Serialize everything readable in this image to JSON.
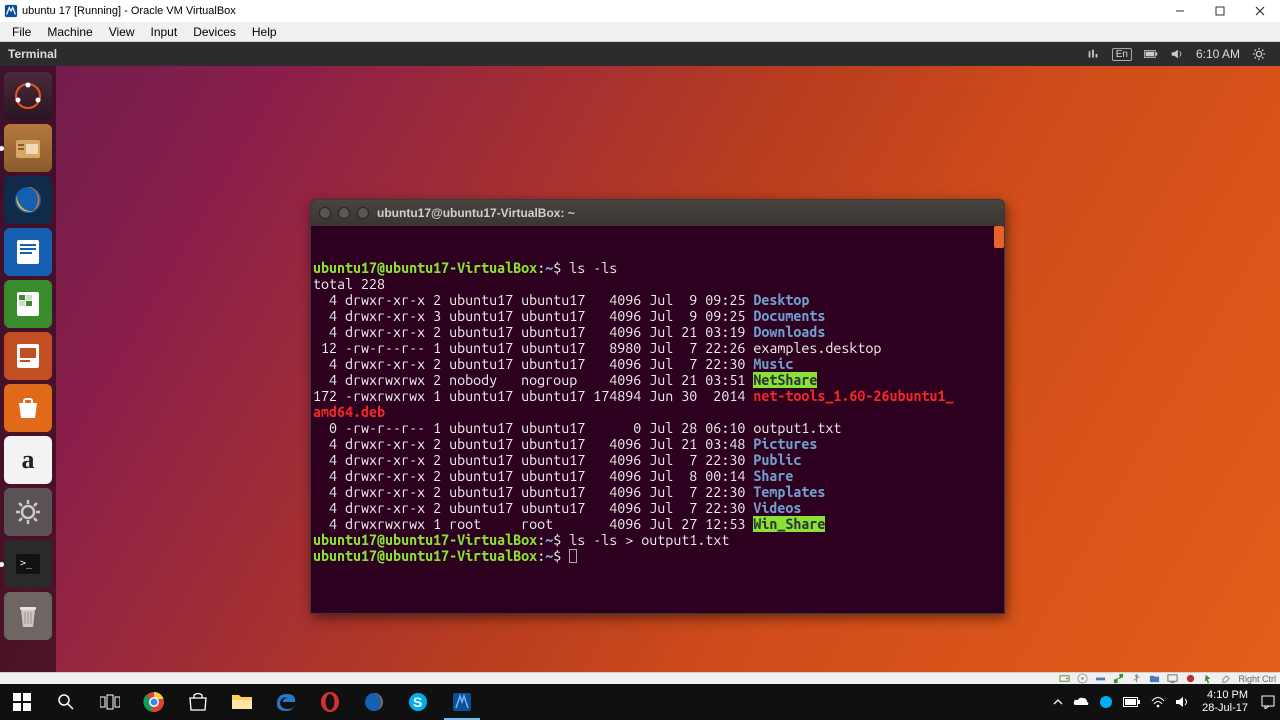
{
  "virtualbox": {
    "title": "ubuntu 17 [Running] - Oracle VM VirtualBox",
    "menu": [
      "File",
      "Machine",
      "View",
      "Input",
      "Devices",
      "Help"
    ],
    "host_key": "Right Ctrl"
  },
  "ubuntu": {
    "active_app": "Terminal",
    "indicators": {
      "lang": "En",
      "time": "6:10 AM"
    }
  },
  "terminal": {
    "title": "ubuntu17@ubuntu17-VirtualBox: ~",
    "prompt_user": "ubuntu17@ubuntu17-VirtualBox",
    "prompt_sep": ":",
    "prompt_path": "~",
    "prompt_end": "$ ",
    "cmd1": "ls -ls",
    "total": "total 228",
    "rows": [
      {
        "pre": "  4 drwxr-xr-x 2 ubuntu17 ubuntu17   4096 Jul  9 09:25 ",
        "name": "Desktop",
        "cls": "p-blue"
      },
      {
        "pre": "  4 drwxr-xr-x 3 ubuntu17 ubuntu17   4096 Jul  9 09:25 ",
        "name": "Documents",
        "cls": "p-blue"
      },
      {
        "pre": "  4 drwxr-xr-x 2 ubuntu17 ubuntu17   4096 Jul 21 03:19 ",
        "name": "Downloads",
        "cls": "p-blue"
      },
      {
        "pre": " 12 -rw-r--r-- 1 ubuntu17 ubuntu17   8980 Jul  7 22:26 ",
        "name": "examples.desktop",
        "cls": "p-white"
      },
      {
        "pre": "  4 drwxr-xr-x 2 ubuntu17 ubuntu17   4096 Jul  7 22:30 ",
        "name": "Music",
        "cls": "p-blue"
      },
      {
        "pre": "  4 drwxrwxrwx 2 nobody   nogroup    4096 Jul 21 03:51 ",
        "name": "NetShare",
        "cls": "p-hlgreen"
      },
      {
        "pre": "172 -rwxrwxrwx 1 ubuntu17 ubuntu17 174894 Jun 30  2014 ",
        "name": "net-tools_1.60-26ubuntu1_",
        "cls": "p-red",
        "wrap": "amd64.deb"
      },
      {
        "pre": "  0 -rw-r--r-- 1 ubuntu17 ubuntu17      0 Jul 28 06:10 ",
        "name": "output1.txt",
        "cls": "p-white"
      },
      {
        "pre": "  4 drwxr-xr-x 2 ubuntu17 ubuntu17   4096 Jul 21 03:48 ",
        "name": "Pictures",
        "cls": "p-blue"
      },
      {
        "pre": "  4 drwxr-xr-x 2 ubuntu17 ubuntu17   4096 Jul  7 22:30 ",
        "name": "Public",
        "cls": "p-blue"
      },
      {
        "pre": "  4 drwxr-xr-x 2 ubuntu17 ubuntu17   4096 Jul  8 00:14 ",
        "name": "Share",
        "cls": "p-blue"
      },
      {
        "pre": "  4 drwxr-xr-x 2 ubuntu17 ubuntu17   4096 Jul  7 22:30 ",
        "name": "Templates",
        "cls": "p-blue"
      },
      {
        "pre": "  4 drwxr-xr-x 2 ubuntu17 ubuntu17   4096 Jul  7 22:30 ",
        "name": "Videos",
        "cls": "p-blue"
      },
      {
        "pre": "  4 drwxrwxrwx 1 root     root       4096 Jul 27 12:53 ",
        "name": "Win_Share",
        "cls": "p-hlgreen"
      }
    ],
    "cmd2": "ls -ls > output1.txt"
  },
  "windows": {
    "tray_time": "4:10 PM",
    "tray_date": "28-Jul-17"
  }
}
